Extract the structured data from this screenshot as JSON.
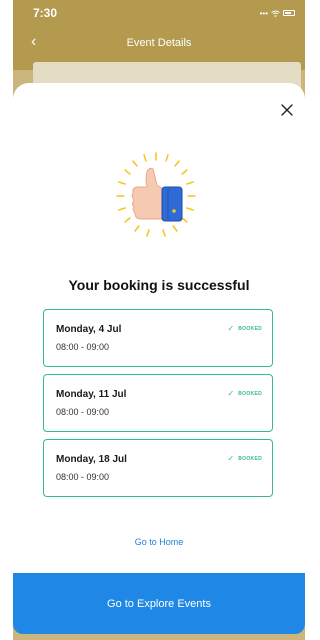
{
  "status_bar": {
    "time": "7:30"
  },
  "background_page": {
    "title": "Event Details"
  },
  "sheet": {
    "headline": "Your booking is successful",
    "bookings": [
      {
        "date": "Monday, 4 Jul",
        "time": "08:00 - 09:00",
        "status": "BOOKED"
      },
      {
        "date": "Monday, 11 Jul",
        "time": "08:00 - 09:00",
        "status": "BOOKED"
      },
      {
        "date": "Monday, 18 Jul",
        "time": "08:00 - 09:00",
        "status": "BOOKED"
      }
    ],
    "go_home_label": "Go to Home",
    "cta_label": "Go to Explore Events"
  },
  "colors": {
    "header_bg": "#b39a4f",
    "accent_green": "#37b896",
    "primary_blue": "#1f87e6",
    "link_blue": "#1f7fe0"
  },
  "icons": [
    "back-chevron-icon",
    "close-icon",
    "thumbs-up-icon",
    "check-icon",
    "wifi-icon",
    "battery-icon"
  ]
}
